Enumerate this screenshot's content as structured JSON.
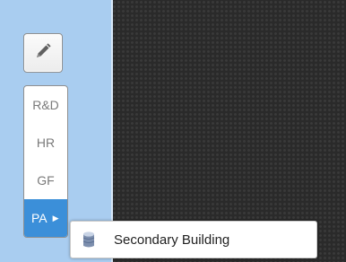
{
  "toolbar": {
    "edit_icon": "pencil-icon"
  },
  "floors": {
    "items": [
      {
        "label": "R&D"
      },
      {
        "label": "HR"
      },
      {
        "label": "GF"
      },
      {
        "label": "PA",
        "selected": true,
        "arrow": "▶"
      }
    ]
  },
  "submenu": {
    "icon": "building-icon",
    "label": "Secondary Building"
  },
  "colors": {
    "panel": "#a9cdf0",
    "selected": "#3b8fd9",
    "background": "#2a2a2a"
  }
}
